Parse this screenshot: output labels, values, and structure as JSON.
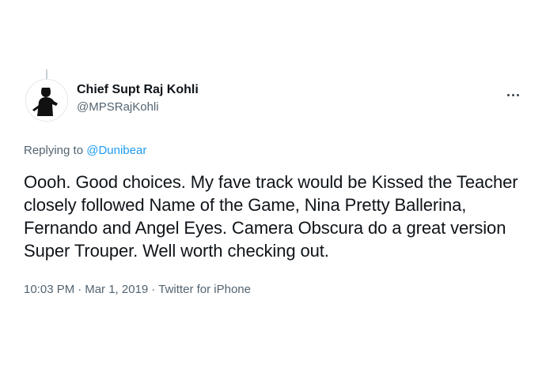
{
  "tweet": {
    "author": {
      "display_name": "Chief Supt Raj Kohli",
      "handle": "@MPSRajKohli"
    },
    "replying_prefix": "Replying to",
    "replying_to": "@Dunibear",
    "text": "Oooh. Good choices. My fave track would be Kissed the Teacher closely followed Name of the Game, Nina Pretty Ballerina, Fernando and Angel Eyes. Camera Obscura do a great version Super Trouper.  Well worth checking out.",
    "time": "10:03 PM",
    "date": "Mar 1, 2019",
    "source": "Twitter for iPhone",
    "separator": "·"
  },
  "icons": {
    "more": "more-horizontal-icon",
    "avatar": "avatar-silhouette"
  },
  "colors": {
    "text": "#0f1419",
    "secondary": "#536471",
    "link": "#1d9bf0"
  }
}
